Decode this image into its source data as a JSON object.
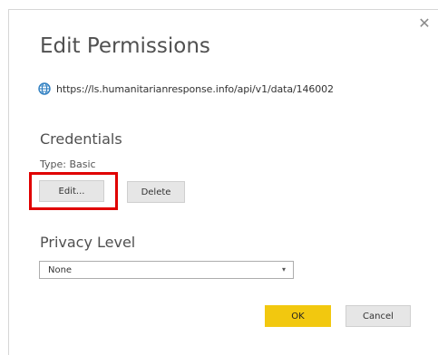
{
  "dialog": {
    "title": "Edit Permissions",
    "close_glyph": "✕",
    "url": "https://ls.humanitarianresponse.info/api/v1/data/146002"
  },
  "credentials": {
    "heading": "Credentials",
    "type_label": "Type: Basic",
    "edit_label": "Edit...",
    "delete_label": "Delete"
  },
  "privacy": {
    "heading": "Privacy Level",
    "selected": "None",
    "chevron_glyph": "▾"
  },
  "footer": {
    "ok_label": "OK",
    "cancel_label": "Cancel"
  },
  "colors": {
    "accent": "#f2c80f",
    "highlight": "#e00000",
    "globe": "#2f7fc1"
  },
  "icons": {
    "url": "globe-icon",
    "close": "close-icon",
    "dropdown": "chevron-down-icon"
  }
}
